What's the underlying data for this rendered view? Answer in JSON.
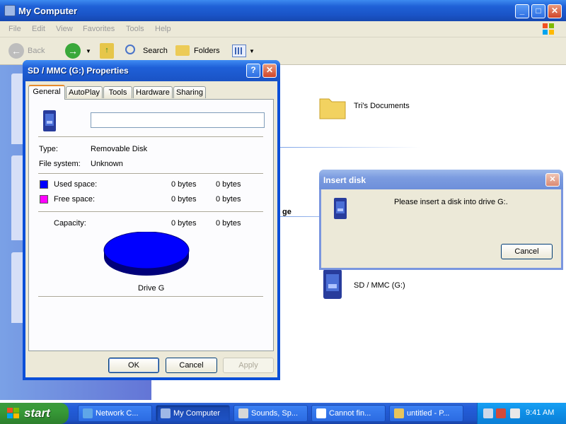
{
  "main_window": {
    "title": "My Computer",
    "menu": [
      "File",
      "Edit",
      "View",
      "Favorites",
      "Tools",
      "Help"
    ],
    "toolbar": {
      "back": "Back",
      "search": "Search",
      "folders": "Folders"
    },
    "content": {
      "folder_label": "Tri's Documents",
      "partial_heading": "ge",
      "drive_label": "SD / MMC (G:)"
    }
  },
  "properties_dialog": {
    "title": "SD / MMC (G:) Properties",
    "tabs": [
      "General",
      "AutoPlay",
      "Tools",
      "Hardware",
      "Sharing"
    ],
    "name_value": "",
    "type_label": "Type:",
    "type_value": "Removable Disk",
    "fs_label": "File system:",
    "fs_value": "Unknown",
    "used_label": "Used space:",
    "used_bytes": "0 bytes",
    "used_bytes2": "0 bytes",
    "free_label": "Free space:",
    "free_bytes": "0 bytes",
    "free_bytes2": "0 bytes",
    "capacity_label": "Capacity:",
    "capacity_bytes": "0 bytes",
    "capacity_bytes2": "0 bytes",
    "drive_caption": "Drive G",
    "buttons": {
      "ok": "OK",
      "cancel": "Cancel",
      "apply": "Apply"
    },
    "colors": {
      "used": "#0000ff",
      "free": "#ff00ff",
      "pie": "#0000ff"
    }
  },
  "insert_dialog": {
    "title": "Insert disk",
    "message": "Please insert a disk into drive G:.",
    "cancel": "Cancel"
  },
  "taskbar": {
    "start": "start",
    "tasks": [
      "Network C...",
      "My Computer",
      "Sounds, Sp...",
      "Cannot fin...",
      "untitled - P..."
    ],
    "clock": "9:41 AM"
  }
}
